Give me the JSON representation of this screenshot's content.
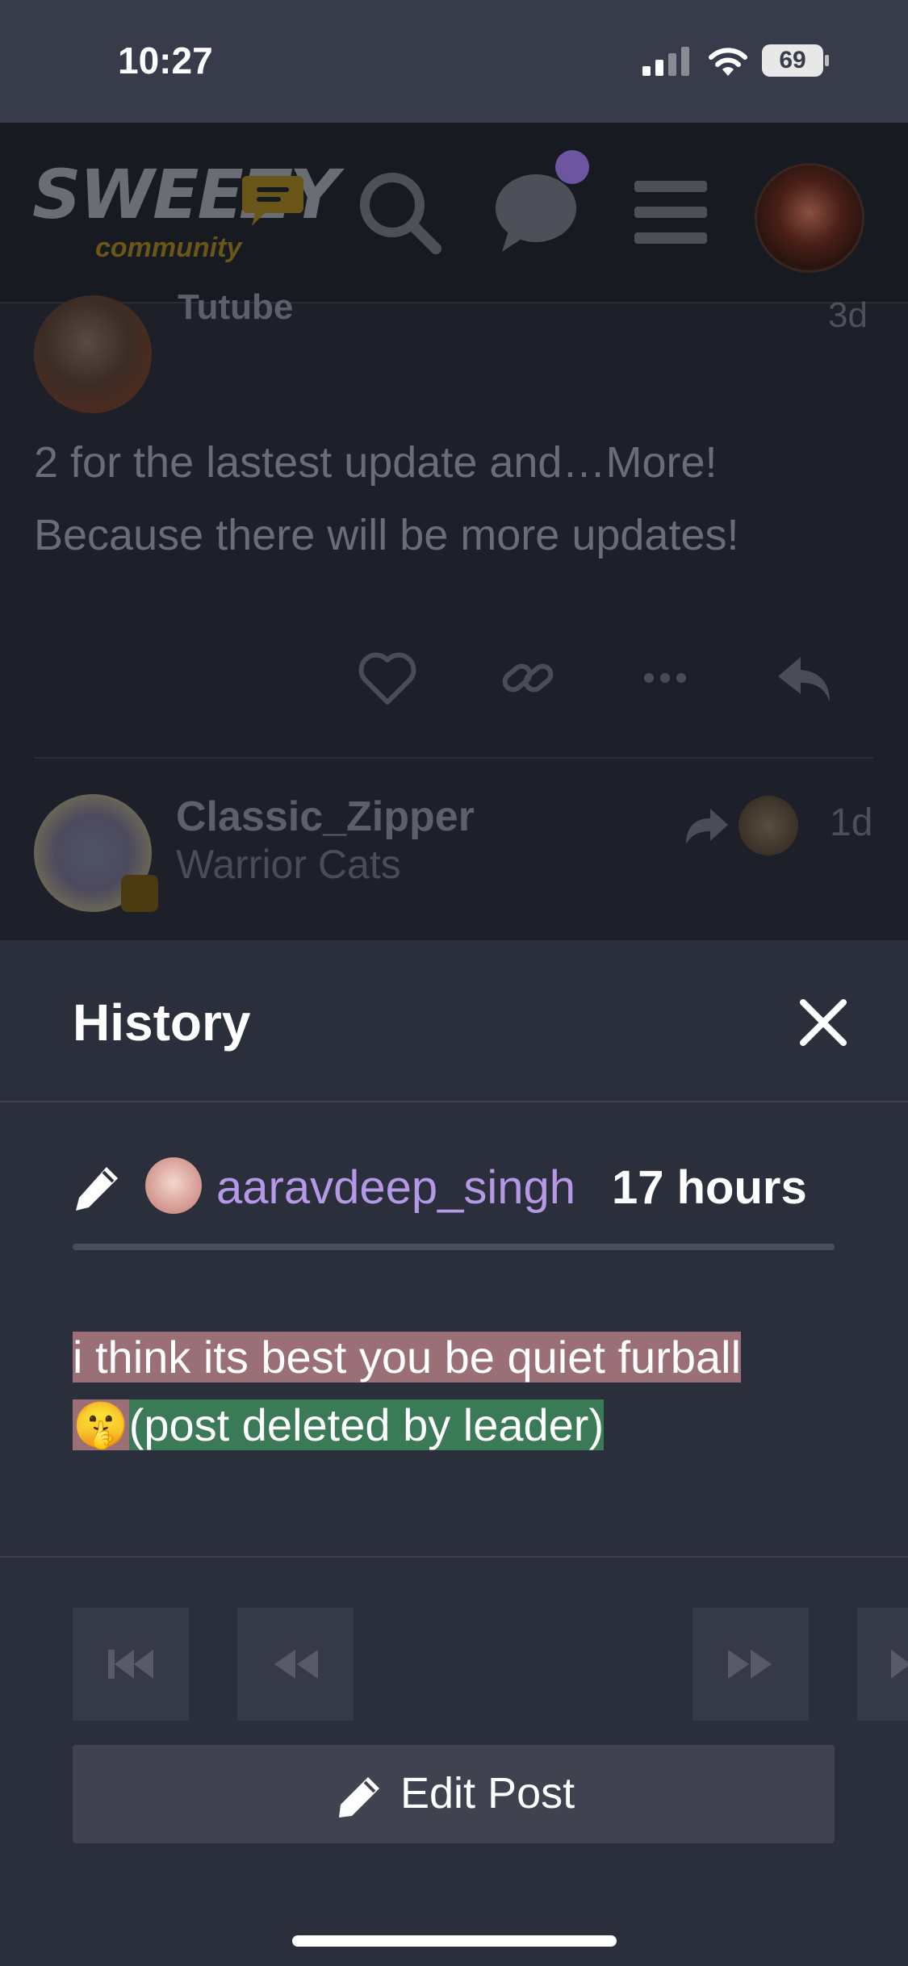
{
  "status_bar": {
    "time": "10:27",
    "battery": "69"
  },
  "header": {
    "logo_text": "SWEEZY",
    "logo_subtitle": "community",
    "icons": [
      "search-icon",
      "chat-icon",
      "menu-icon"
    ],
    "has_notification": true
  },
  "background_posts": [
    {
      "username": "Tutube",
      "time": "3d",
      "body": "2 for the lastest update and…More! Because there will be more updates!"
    },
    {
      "username": "Classic_Zipper",
      "flair": "Warrior Cats",
      "time": "1d"
    }
  ],
  "history": {
    "title": "History",
    "author": "aaravdeep_singh",
    "time": "17 hours",
    "removed_text": "i think its best you be quiet furball",
    "removed_emoji": "🤫",
    "added_text": "(post deleted by leader)",
    "edit_button_label": "Edit Post"
  },
  "colors": {
    "modal_bg": "#2b2e3b",
    "username": "#b598e6",
    "diff_removed": "#9a7076",
    "diff_added": "#3a7a56"
  }
}
